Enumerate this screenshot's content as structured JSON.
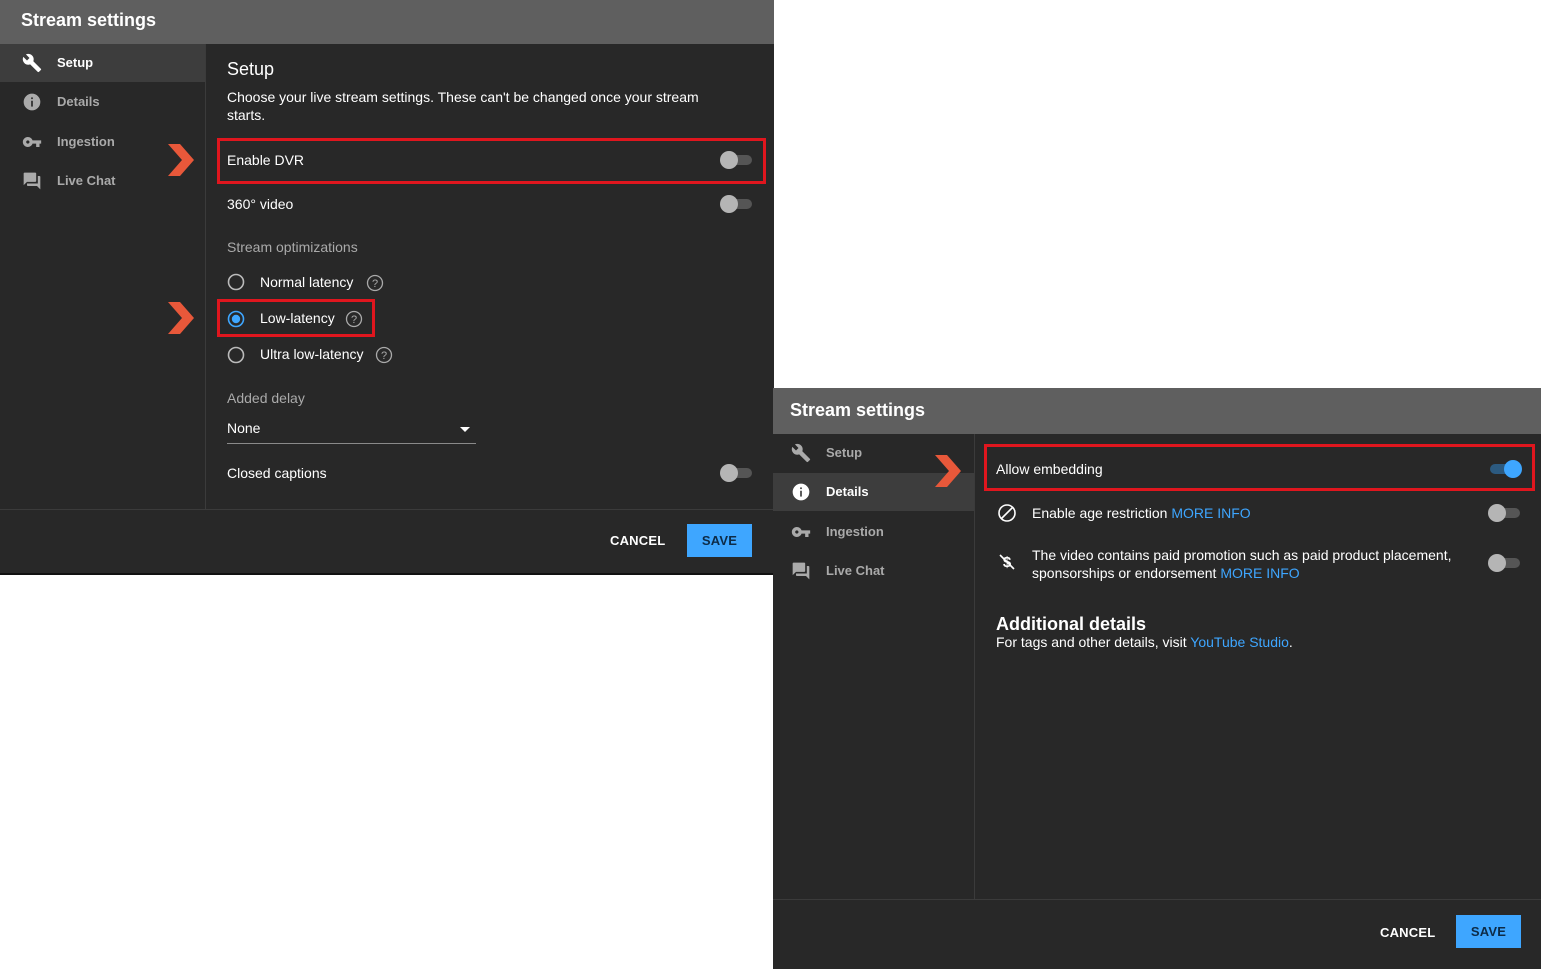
{
  "panel_a": {
    "title": "Stream settings",
    "nav": [
      {
        "label": "Setup",
        "icon": "wrench-icon",
        "active": true
      },
      {
        "label": "Details",
        "icon": "info-icon",
        "active": false
      },
      {
        "label": "Ingestion",
        "icon": "key-icon",
        "active": false
      },
      {
        "label": "Live Chat",
        "icon": "chat-icon",
        "active": false
      }
    ],
    "heading": "Setup",
    "description_line1": "Choose your live stream settings. These can't be changed once your stream",
    "description_line2": "starts.",
    "enable_dvr": {
      "label": "Enable DVR",
      "on": false
    },
    "video_360": {
      "label": "360° video",
      "on": false
    },
    "stream_optimizations_label": "Stream optimizations",
    "latency_options": [
      {
        "label": "Normal latency",
        "selected": false
      },
      {
        "label": "Low-latency",
        "selected": true
      },
      {
        "label": "Ultra low-latency",
        "selected": false
      }
    ],
    "added_delay": {
      "label": "Added delay",
      "value": "None"
    },
    "closed_captions": {
      "label": "Closed captions",
      "on": false
    },
    "cancel_label": "CANCEL",
    "save_label": "SAVE"
  },
  "panel_b": {
    "title": "Stream settings",
    "nav": [
      {
        "label": "Setup",
        "icon": "wrench-icon",
        "active": false
      },
      {
        "label": "Details",
        "icon": "info-icon",
        "active": true
      },
      {
        "label": "Ingestion",
        "icon": "key-icon",
        "active": false
      },
      {
        "label": "Live Chat",
        "icon": "chat-icon",
        "active": false
      }
    ],
    "allow_embedding": {
      "label": "Allow embedding",
      "on": true
    },
    "age_restriction": {
      "label": "Enable age restriction",
      "link": "MORE INFO",
      "on": false
    },
    "paid_promotion": {
      "line1": "The video contains paid promotion such as paid product placement,",
      "line2": "sponsorships or endorsement",
      "link": "MORE INFO",
      "on": false
    },
    "additional_details_heading": "Additional details",
    "additional_details_text": "For tags and other details, visit",
    "additional_details_link": "YouTube Studio",
    "additional_details_end": ".",
    "cancel_label": "CANCEL",
    "save_label": "SAVE"
  },
  "colors": {
    "accent": "#3ea6ff",
    "highlight": "#e0161e",
    "arrow": "#e8583a",
    "panel_bg": "#282828",
    "titlebar_bg": "#5f5f5f"
  }
}
